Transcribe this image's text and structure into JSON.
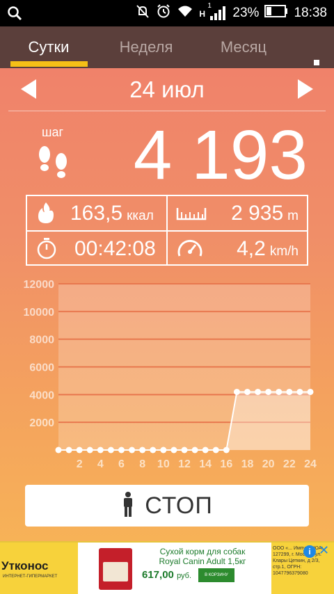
{
  "status_bar": {
    "network": "H",
    "sim": "1",
    "battery": "23%",
    "time": "18:38"
  },
  "tabs": [
    {
      "label": "Сутки",
      "active": true
    },
    {
      "label": "Неделя",
      "active": false
    },
    {
      "label": "Месяц",
      "active": false
    }
  ],
  "date": "24 июл",
  "steps": {
    "label": "шаг",
    "value": "4 193"
  },
  "stats": {
    "calories": {
      "value": "163,5",
      "unit": "ккал"
    },
    "distance": {
      "value": "2 935",
      "unit": "m"
    },
    "duration": {
      "value": "00:42:08"
    },
    "speed": {
      "value": "4,2",
      "unit": "km/h"
    }
  },
  "chart_data": {
    "type": "area",
    "ylim": [
      0,
      12000
    ],
    "xlim": [
      0,
      24
    ],
    "yticks": [
      "12000",
      "10000",
      "8000",
      "6000",
      "4000",
      "2000"
    ],
    "xticks": [
      "2",
      "4",
      "6",
      "8",
      "10",
      "12",
      "14",
      "16",
      "18",
      "20",
      "22",
      "24"
    ],
    "x": [
      0,
      1,
      2,
      3,
      4,
      5,
      6,
      7,
      8,
      9,
      10,
      11,
      12,
      13,
      14,
      15,
      16,
      17,
      18,
      19,
      20,
      21,
      22,
      23,
      24
    ],
    "values": [
      0,
      0,
      0,
      0,
      0,
      0,
      0,
      0,
      0,
      0,
      0,
      0,
      0,
      0,
      0,
      0,
      0,
      4193,
      4193,
      4193,
      4193,
      4193,
      4193,
      4193,
      4193
    ],
    "grid": true,
    "colors": {
      "line": "#ffffff",
      "fill": "rgba(255,255,255,0.35)",
      "grid": "#e8774e"
    }
  },
  "stop_button": {
    "label": "СТОП"
  },
  "ad": {
    "brand": "Утконос",
    "brand_sub": "ИНТЕРНЕТ-ГИПЕРМАРКЕТ",
    "title_line1": "Сухой корм для собак",
    "title_line2": "Royal Canin Adult 1,5кг",
    "price": "617,00",
    "currency": "руб.",
    "cart": "В КОРЗИНУ",
    "legal": "ООО «... Импул... ЮА: 127299, г. Москва, ул. Клары Цеткин, д 2/3, стр.1, ОГРН: 1047796379080"
  },
  "colors": {
    "tabbar": "#5b3f3b",
    "tab_indicator": "#f5c017",
    "gradient_top": "#f0826a",
    "gradient_bottom": "#f7b257"
  }
}
